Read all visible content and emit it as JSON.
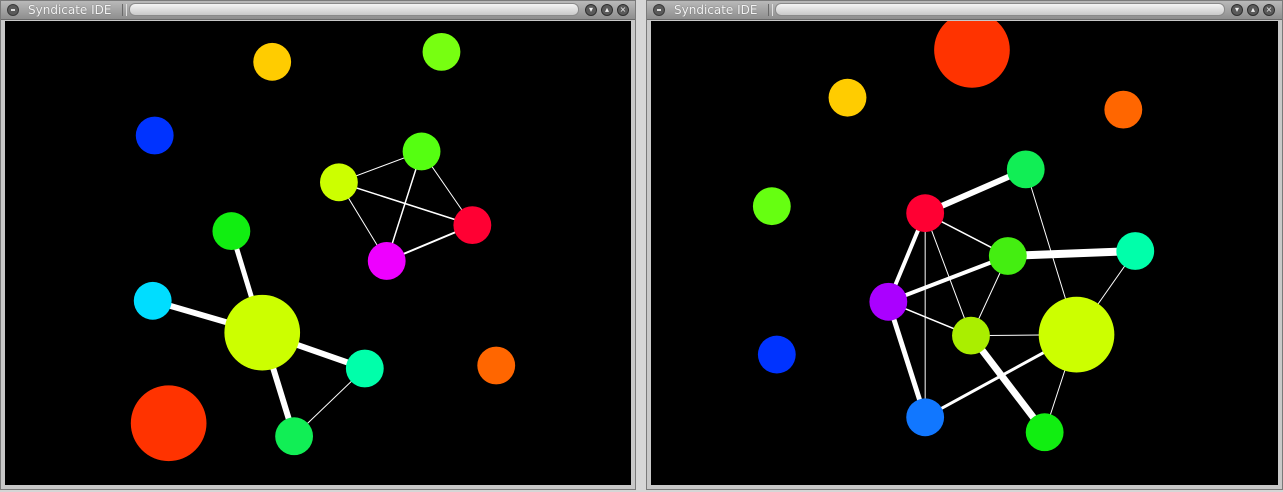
{
  "windows": [
    {
      "title": "Syndicate IDE",
      "nodes": [
        {
          "id": "n1",
          "color": "#FFCC00"
        },
        {
          "id": "n2",
          "color": "#77FF11"
        },
        {
          "id": "n3",
          "color": "#0033FF"
        },
        {
          "id": "n4",
          "color": "#CCFF00"
        },
        {
          "id": "n5",
          "color": "#55FF11"
        },
        {
          "id": "n6",
          "color": "#FF0033"
        },
        {
          "id": "n7",
          "color": "#EE00FF"
        },
        {
          "id": "n8",
          "color": "#11EE11"
        },
        {
          "id": "n9",
          "color": "#00DDFF"
        },
        {
          "id": "n10",
          "color": "#CCFF00"
        },
        {
          "id": "n11",
          "color": "#00FFAA"
        },
        {
          "id": "n12",
          "color": "#FF6600"
        },
        {
          "id": "n13",
          "color": "#FF3300"
        },
        {
          "id": "n14",
          "color": "#11EE55"
        }
      ]
    },
    {
      "title": "Syndicate IDE",
      "nodes": [
        {
          "id": "m1",
          "color": "#FF3300"
        },
        {
          "id": "m2",
          "color": "#FFCC00"
        },
        {
          "id": "m3",
          "color": "#FF6600"
        },
        {
          "id": "m4",
          "color": "#11EE55"
        },
        {
          "id": "m5",
          "color": "#66FF11"
        },
        {
          "id": "m6",
          "color": "#FF0033"
        },
        {
          "id": "m7",
          "color": "#00FFAA"
        },
        {
          "id": "m8",
          "color": "#44EE11"
        },
        {
          "id": "m9",
          "color": "#AA00FF"
        },
        {
          "id": "m10",
          "color": "#CCFF00"
        },
        {
          "id": "m11",
          "color": "#AAEE00"
        },
        {
          "id": "m12",
          "color": "#0033FF"
        },
        {
          "id": "m13",
          "color": "#1177FF"
        },
        {
          "id": "m14",
          "color": "#11EE11"
        }
      ]
    }
  ]
}
